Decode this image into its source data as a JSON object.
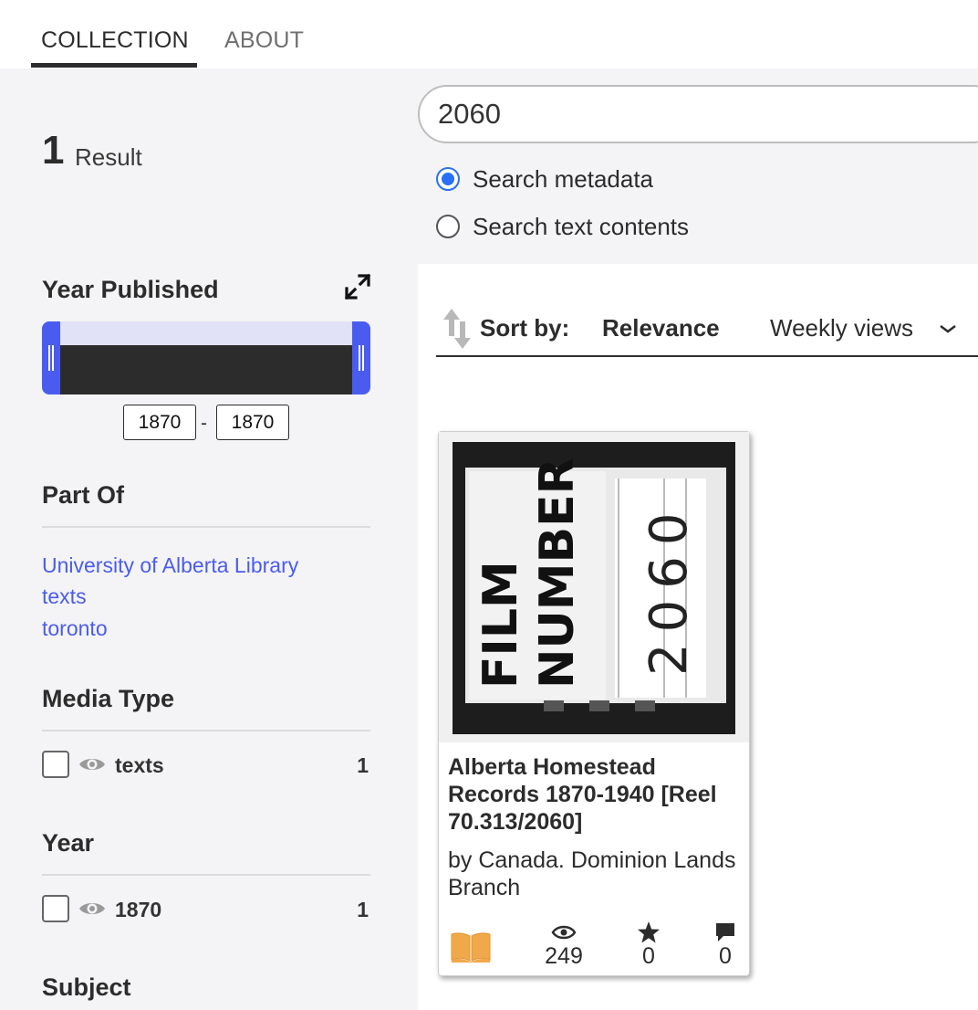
{
  "tabs": {
    "collection": "COLLECTION",
    "about": "ABOUT"
  },
  "results": {
    "count": "1",
    "label": "Result"
  },
  "search": {
    "query": "2060",
    "options": {
      "metadata": "Search metadata",
      "text": "Search text contents"
    },
    "selected": "metadata"
  },
  "facets": {
    "year_published": {
      "title": "Year Published",
      "from": "1870",
      "to": "1870",
      "separator": "-"
    },
    "part_of": {
      "title": "Part Of",
      "links": [
        "University of Alberta Library",
        "texts",
        "toronto"
      ]
    },
    "media_type": {
      "title": "Media Type",
      "items": [
        {
          "label": "texts",
          "count": "1"
        }
      ]
    },
    "year": {
      "title": "Year",
      "items": [
        {
          "label": "1870",
          "count": "1"
        }
      ]
    },
    "subject": {
      "title": "Subject"
    }
  },
  "sort": {
    "label": "Sort by:",
    "options": [
      "Relevance",
      "Weekly views"
    ],
    "active": "Relevance"
  },
  "items": [
    {
      "title": "Alberta Homestead Records 1870-1940 [Reel 70.313/2060]",
      "creator": "by Canada. Dominion Lands Branch",
      "thumbnail_text": {
        "line1": "FILM",
        "line2": "NUMBER",
        "line3": "2060"
      },
      "mediatype_icon": "book-icon",
      "views": "249",
      "favorites": "0",
      "reviews": "0"
    }
  ],
  "colors": {
    "accent": "#4a5cf0",
    "radio": "#2a6ff6",
    "book": "#f0a94a",
    "sidebar_bg": "#f4f4f6"
  }
}
